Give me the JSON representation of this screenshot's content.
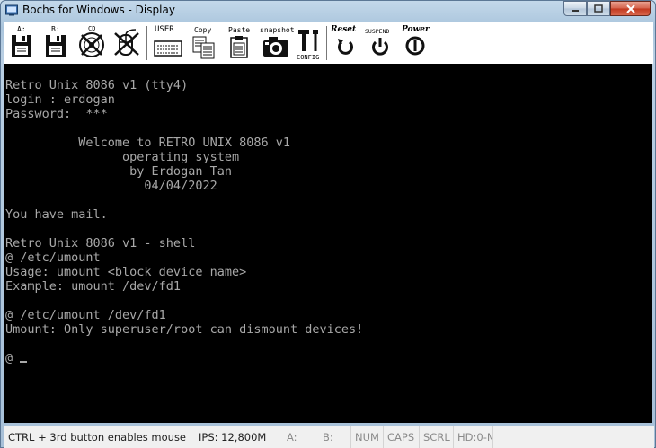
{
  "window": {
    "title": "Bochs for Windows - Display"
  },
  "toolbar": {
    "floppy_a": "A:",
    "floppy_b": "B:",
    "cdrom": "CD",
    "user": "USER",
    "copy": "Copy",
    "paste": "Paste",
    "snapshot": "snapshot",
    "config": "CONFIG",
    "reset": "Reset",
    "suspend": "SUSPEND",
    "power": "Power"
  },
  "terminal": {
    "lines": [
      "Retro Unix 8086 v1 (tty4)",
      "login : erdogan",
      "Password:  ***",
      "",
      "          Welcome to RETRO UNIX 8086 v1",
      "                operating system",
      "                 by Erdogan Tan",
      "                   04/04/2022",
      "",
      "You have mail.",
      "",
      "Retro Unix 8086 v1 - shell",
      "@ /etc/umount",
      "Usage: umount <block device name>",
      "Example: umount /dev/fd1",
      "",
      "@ /etc/umount /dev/fd1",
      "Umount: Only superuser/root can dismount devices!",
      "",
      "@ "
    ]
  },
  "statusbar": {
    "hint": "CTRL + 3rd button enables mouse",
    "ips": "IPS: 12,800M",
    "a": "A:",
    "b": "B:",
    "num": "NUM",
    "caps": "CAPS",
    "scrl": "SCRL",
    "hd": "HD:0-M"
  }
}
